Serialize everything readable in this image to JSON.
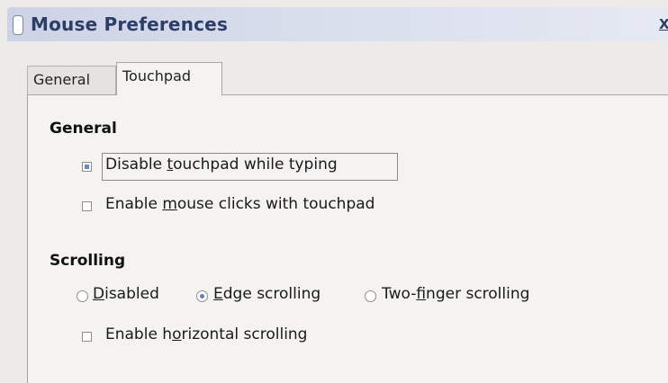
{
  "window": {
    "title": "Mouse Preferences",
    "close_glyph": "X",
    "icon": "window-icon"
  },
  "tabs": [
    {
      "label": "General",
      "active": false
    },
    {
      "label": "Touchpad",
      "active": true
    }
  ],
  "general_section": {
    "title": "General",
    "disable_while_typing": {
      "pre": "Disable ",
      "mnemonic": "t",
      "post": "ouchpad while typing",
      "checked": true
    },
    "mouse_clicks": {
      "pre": "Enable ",
      "mnemonic": "m",
      "post": "ouse clicks with touchpad",
      "checked": false
    }
  },
  "scrolling_section": {
    "title": "Scrolling",
    "disabled": {
      "pre": "",
      "mnemonic": "D",
      "post": "isabled",
      "checked": false
    },
    "edge": {
      "pre": "",
      "mnemonic": "E",
      "post": "dge scrolling",
      "checked": true
    },
    "two_finger": {
      "pre": "Two-",
      "mnemonic": "f",
      "post": "inger scrolling",
      "checked": false
    },
    "horizontal": {
      "pre": "Enable h",
      "mnemonic": "o",
      "post": "rizontal scrolling",
      "checked": false
    }
  },
  "colors": {
    "title_text": "#2d3e66",
    "check_accent": "#6a87c9"
  }
}
